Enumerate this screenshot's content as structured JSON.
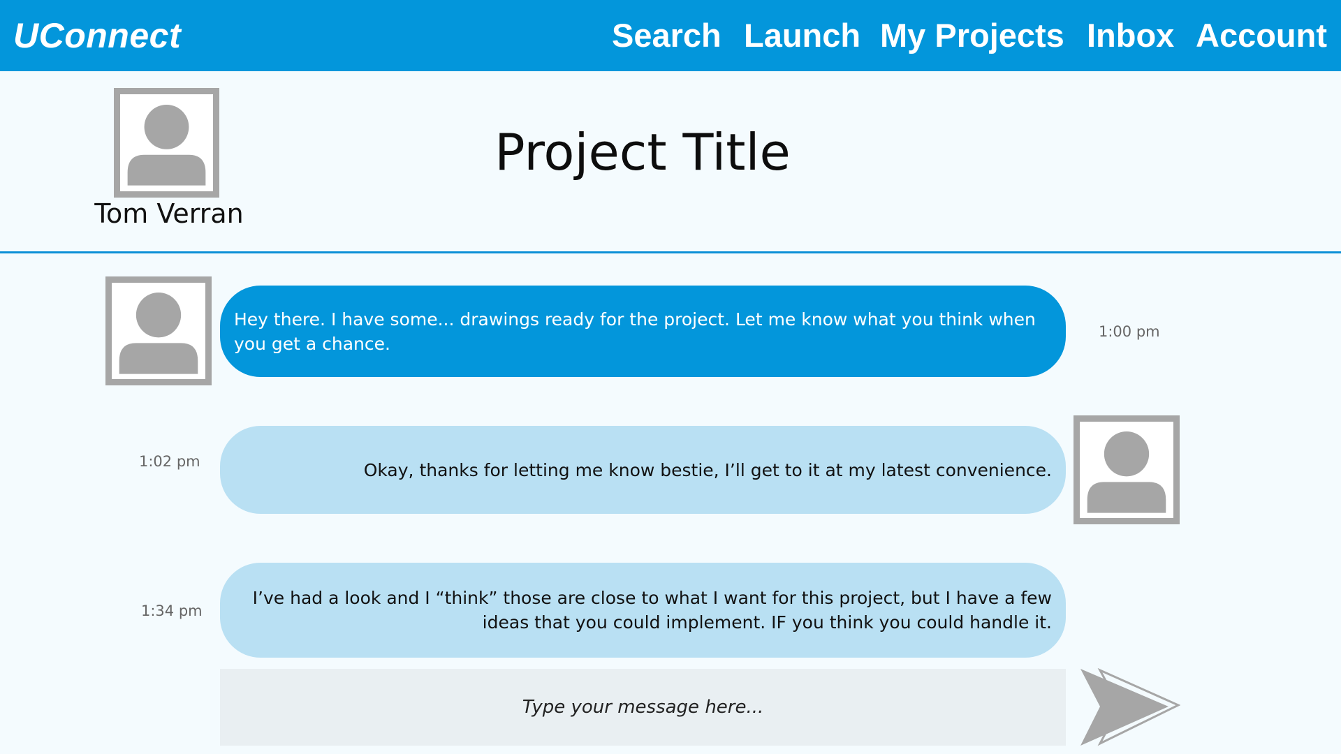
{
  "app": {
    "brand": "UConnect"
  },
  "nav": {
    "search": "Search",
    "launch": "Launch",
    "my_projects": "My Projects",
    "inbox": "Inbox",
    "account": "Account"
  },
  "project": {
    "title": "Project Title",
    "owner_name": "Tom Verran"
  },
  "messages": [
    {
      "direction": "incoming",
      "text": "Hey there. I have some... drawings ready for the project. Let me know what you think when you get a chance.",
      "time": "1:00 pm"
    },
    {
      "direction": "outgoing",
      "text": "Okay, thanks for letting me know bestie, I’ll get to it at my latest convenience.",
      "time": "1:02 pm"
    },
    {
      "direction": "outgoing",
      "text": "I’ve had a look and I “think” those are close to what I want for this project, but I have a few ideas that you could implement. IF you think you could handle it.",
      "time": "1:34 pm"
    }
  ],
  "composer": {
    "placeholder": "Type your message here...",
    "value": ""
  },
  "icons": {
    "avatar": "user-avatar-icon",
    "send": "send-arrow-icon"
  },
  "colors": {
    "header": "#0396db",
    "incoming_bubble": "#0396db",
    "outgoing_bubble": "#b9e0f3",
    "avatar_frame": "#a6a6a6",
    "composer": "#e9eff2",
    "background": "#f4fbfe"
  }
}
